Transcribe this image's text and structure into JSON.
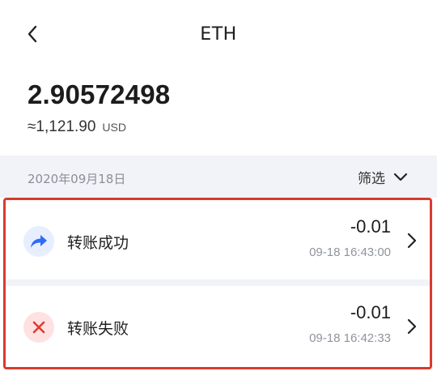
{
  "header": {
    "title": "ETH",
    "back_icon": "chevron-left-icon"
  },
  "balance": {
    "amount": "2.90572498",
    "fiat_amount": "≈1,121.90",
    "fiat_unit": "USD"
  },
  "filter_bar": {
    "date": "2020年09月18日",
    "filter_label": "筛选",
    "filter_icon": "chevron-down-icon"
  },
  "transactions": [
    {
      "label": "转账成功",
      "amount": "-0.01",
      "time": "09-18 16:43:00",
      "icon": "share-arrow-icon",
      "icon_color": "#2f6bf6",
      "icon_bg": "#e7eeff"
    },
    {
      "label": "转账失败",
      "amount": "-0.01",
      "time": "09-18 16:42:33",
      "icon": "close-x-icon",
      "icon_color": "#e03b33",
      "icon_bg": "#fde2e1"
    }
  ],
  "colors": {
    "highlight_border": "#d93a2e",
    "section_bg": "#f2f3f8"
  }
}
